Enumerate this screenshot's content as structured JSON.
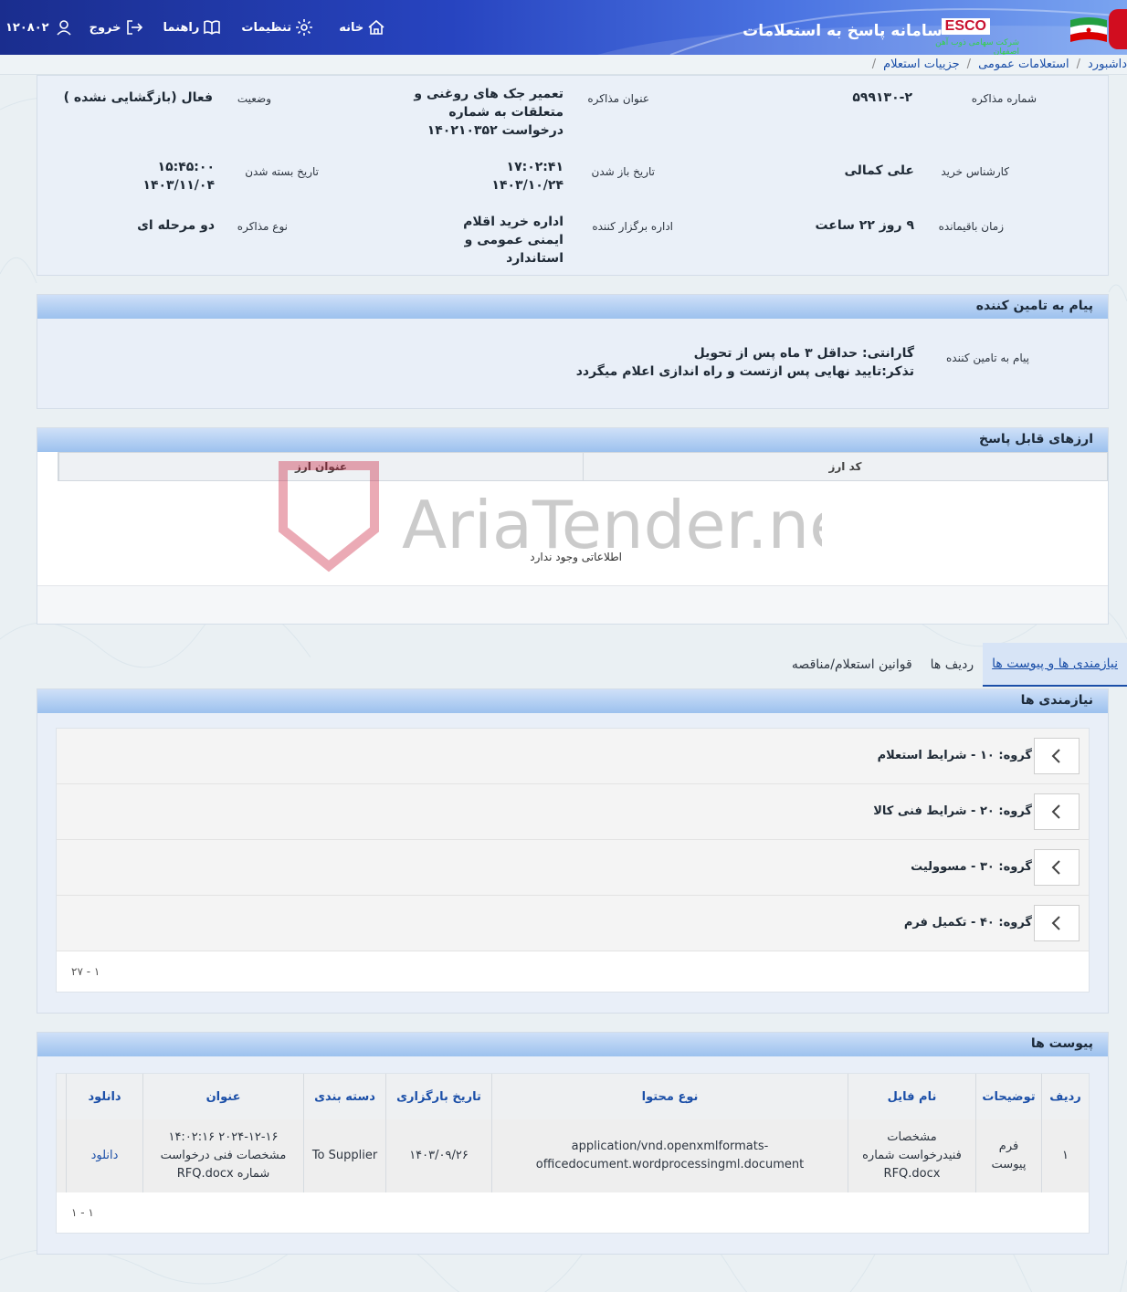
{
  "header": {
    "system_title": "سامانه پاسخ به استعلامات",
    "brand": "ESCO",
    "brand_subtitle": "شرکت سهامی ذوب آهن اصفهان",
    "nav": {
      "home": "خانه",
      "settings": "تنظیمات",
      "guide": "راهنما",
      "logout": "خروج",
      "user_id": "۱۲۰۸۰۲"
    }
  },
  "breadcrumb": [
    "داشبورد",
    "استعلامات عمومی",
    "جزییات استعلام"
  ],
  "details": {
    "negotiation_number_label": "شماره مذاکره",
    "negotiation_number": "۵۹۹۱۳۰-۲",
    "negotiation_title_label": "عنوان مذاکره",
    "negotiation_title": "تعمیر جک های روغنی و متعلقات به شماره درخواست ۱۴۰۲۱۰۳۵۲",
    "status_label": "وضعیت",
    "status": "فعال (بازگشایی نشده )",
    "buyer_label": "کارشناس خرید",
    "buyer": "علی کمالی",
    "open_date_label": "تاریخ باز شدن",
    "open_time": "۱۷:۰۲:۴۱",
    "open_date": "۱۴۰۳/۱۰/۲۴",
    "close_date_label": "تاریخ بسته شدن",
    "close_time": "۱۵:۴۵:۰۰",
    "close_date": "۱۴۰۳/۱۱/۰۴",
    "remaining_label": "زمان باقیمانده",
    "remaining": "۹ روز ۲۲ ساعت",
    "organizer_label": "اداره برگزار کننده",
    "organizer": "اداره خرید اقلام ایمنی عمومی و استاندارد",
    "type_label": "نوع مذاکره",
    "type": "دو مرحله ای"
  },
  "supplier_message": {
    "title": "پیام به تامین کننده",
    "label": "پیام به تامین کننده",
    "line1": "گارانتی: حداقل ۳ ماه پس از تحویل",
    "line2": "تذکر:تایید نهایی پس ازتست و راه اندازی اعلام میگردد"
  },
  "currencies": {
    "title": "ارزهای قابل پاسخ",
    "col_code": "کد ارز",
    "col_title": "عنوان ارز",
    "empty": "اطلاعاتی وجود ندارد"
  },
  "tabs": [
    "نیازمندی ها و پیوست ها",
    "ردیف ها",
    "قوانین استعلام/مناقصه"
  ],
  "requirements": {
    "title": "نیازمندی ها",
    "groups": [
      "گروه: ۱۰ - شرایط استعلام",
      "گروه: ۲۰ - شرایط فنی کالا",
      "گروه: ۳۰ - مسوولیت",
      "گروه: ۴۰ - تکمیل فرم"
    ],
    "pager": "۱ - ۲۷"
  },
  "attachments": {
    "title": "پیوست ها",
    "headers": [
      "ردیف",
      "توضیحات",
      "نام فایل",
      "نوع محتوا",
      "تاریخ بارگزاری",
      "دسته بندی",
      "عنوان",
      "دانلود"
    ],
    "rows": [
      {
        "index": "۱",
        "description": "فرم پیوست",
        "file_name": "مشخصات فنیدرخواست شماره RFQ.docx",
        "content_type": "application/vnd.openxmlformats-officedocument.wordprocessingml.document",
        "upload_date": "۱۴۰۳/۰۹/۲۶",
        "category": "To Supplier",
        "title": "۲۰۲۴-۱۲-۱۶ ۱۴:۰۲:۱۶ مشخصات فنی درخواست شماره RFQ.docx",
        "download": "دانلود"
      }
    ],
    "pager": "۱ - ۱"
  },
  "watermark": "AriaTender.neT",
  "colors": {
    "accent": "#1b4fa8",
    "topbar": "#2744c0",
    "panel_head": "#9cc1ee"
  }
}
